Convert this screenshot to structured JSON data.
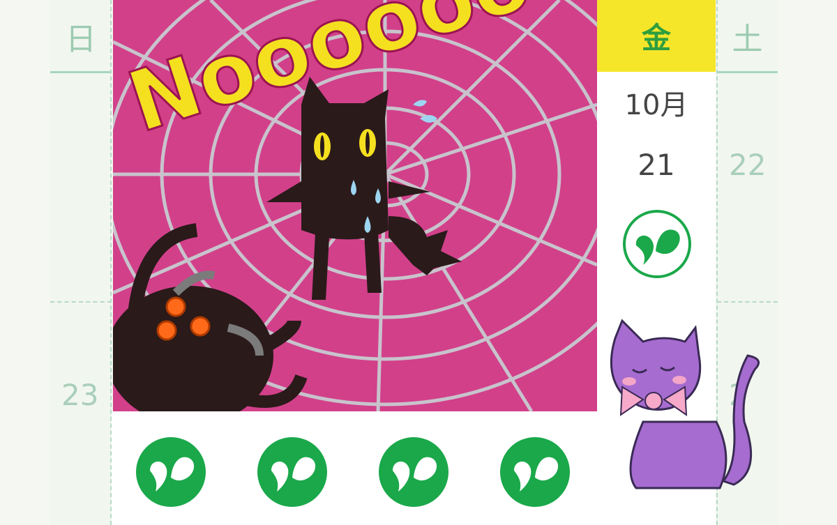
{
  "calendar": {
    "weekday_sun": "日",
    "weekday_fri": "金",
    "weekday_sat": "土",
    "month": "10月",
    "today_date": "21",
    "date_sat": "22",
    "date_sun": "23",
    "date_mon_partial": "2"
  },
  "sticker": {
    "text": "Nooooooo!!",
    "bg_color": "#d2408a"
  },
  "colors": {
    "today_highlight": "#f6e62a",
    "stamp_green": "#1aa84a"
  },
  "icons": {
    "stamp": "heart-stamp-icon"
  }
}
